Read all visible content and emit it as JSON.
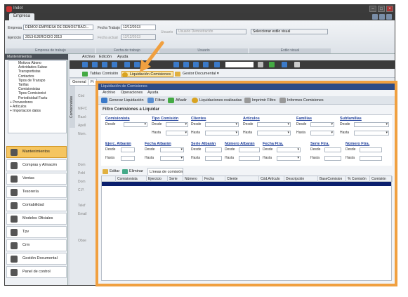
{
  "app": {
    "title": "Indot"
  },
  "ribbon": {
    "tab": "Empresa",
    "empresa_label": "Empresa",
    "empresa_value": "DEMO2-EMPRESA DE DEMOSTRACI...",
    "ejercicio_label": "Ejercicio",
    "ejercicio_value": "2013-EJERCICIO 2013",
    "fecha_trabajo_label": "Fecha Trabajo",
    "fecha_trabajo_value": "12/12/2013",
    "fecha_actual_label": "Fecha actual",
    "fecha_actual_value": "12/12/2013",
    "usuario_label": "Usuario",
    "usuario_value": "Usuario Demostración",
    "estilo_value": "Seleccionar estilo visual",
    "group_empresa": "Empresa de trabajo",
    "group_fecha": "Fecha de trabajo",
    "group_usuario": "Usuario",
    "group_estilo": "Estilo visual"
  },
  "sidebar": {
    "header": "Mantenimientos",
    "tree": [
      "Motivos Abono",
      "Actividades-Subac",
      "Transportistas",
      "Contactos",
      "Tipos de Transpo",
      "Tarifas",
      "Comisionistas",
      "Tipos Comisionist",
      "Periodicidad Factu",
      "+ Proveedores",
      "+ Artículos",
      "+ Importacion datos"
    ],
    "modules": [
      "Mantenimientos",
      "Compras y Almacén",
      "Ventas",
      "Tesorería",
      "Contabilidad",
      "Modelos Oficiales",
      "Tpv",
      "Crm",
      "Gestión Documental",
      "Panel de control"
    ]
  },
  "main": {
    "menu": [
      "Archivo",
      "Edición",
      "Ayuda"
    ],
    "sub": [
      "Tablas Comisión",
      "Liquidación Comisiones",
      "Gestor Documental"
    ],
    "tabs": [
      "General",
      "Fi"
    ],
    "side_tab": "Comisionistas",
    "form_labels": [
      "Cód",
      "NIF/C",
      "Razó",
      "Apell",
      "Nom.",
      "Dom",
      "Pobl",
      "Dom",
      "C.P.",
      "Telef",
      "Email",
      "Obse"
    ]
  },
  "dialog": {
    "title": "Liquidación de Comisiones",
    "menu": [
      "Archivo",
      "Operaciones",
      "Ayuda"
    ],
    "toolbar": [
      "Generar Liquidación",
      "Filtrar",
      "Añadir",
      "Liquidaciones realizadas",
      "Imprimir Filtro",
      "Informes Comisiones"
    ],
    "filter_title": "Filtro Comisiones a Liquidar",
    "fields_row1": [
      "Comisionista",
      "Tipo Comisión",
      "Clientes",
      "Artículos",
      "Familias",
      "Subfamilias"
    ],
    "fields_row2": [
      "Ejerc. Albarán",
      "Fecha Albarán",
      "Serie Albarán",
      "Número Albarán",
      "Fecha Ftra.",
      "Serie Ftra.",
      "Número Ftra."
    ],
    "desde": "Desde",
    "hasta": "Hasta",
    "grid_tabs": [
      "Editar",
      "Eliminar",
      "Líneas de comisión"
    ],
    "columns": [
      "Comisionista",
      "Ejercicio",
      "Serie",
      "Número",
      "Fecha",
      "Cliente",
      "Cód.Artículo",
      "Descripción",
      "BaseComision",
      "% Comisión",
      "Comisión"
    ]
  },
  "colors": {
    "accent": "#f0a040",
    "selected_row": "#0a1f6e",
    "link": "#1f3f9a"
  }
}
